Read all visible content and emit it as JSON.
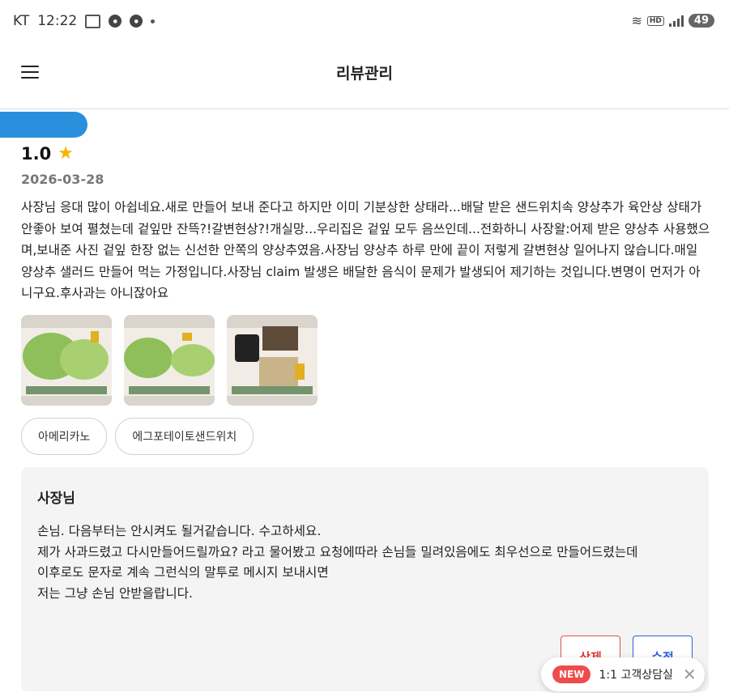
{
  "status_bar": {
    "carrier": "KT",
    "time": "12:22",
    "battery": "49"
  },
  "header": {
    "title": "리뷰관리"
  },
  "review": {
    "rating": "1.0",
    "date": "2026-03-28",
    "text": "사장님 응대 많이 아쉽네요.새로 만들어 보내 준다고 하지만 이미 기분상한 상태라...배달 받은 샌드위치속 양상추가 육안상 상태가 안좋아 보여 펼쳤는데 겉잎만 잔뜩?!갈변현상?!개실망...우리집은 겉잎 모두 음쓰인데...전화하니 사장왈:어제 받은 양상추 사용했으며,보내준 사진 겉잎 한장 없는 신선한 안쪽의 양상추였음.사장님 양상추 하루 만에 끝이 저렇게 갈변현상 일어나지 않습니다.매일 양상추 샐러드 만들어 먹는 가정입니다.사장님 claim 발생은 배달한 음식이 문제가 발생되어 제기하는 것입니다.변명이 먼저가 아니구요.후사과는 아니잖아요",
    "tags": [
      "아메리카노",
      "에그포테이토샌드위치"
    ]
  },
  "owner_reply": {
    "title": "사장님",
    "text": "손님. 다음부터는 안시켜도 될거같습니다. 수고하세요.\n제가 사과드렸고 다시만들어드릴까요? 라고 물어봤고 요청에따라 손님들 밀려있음에도 최우선으로 만들어드렸는데\n이후로도 문자로 계속 그런식의 말투로 메시지 보내시면\n저는 그냥 손님 안받을랍니다.",
    "delete_label": "삭제",
    "edit_label": "수정"
  },
  "chat": {
    "badge": "NEW",
    "label": "1:1 고객상담실"
  }
}
